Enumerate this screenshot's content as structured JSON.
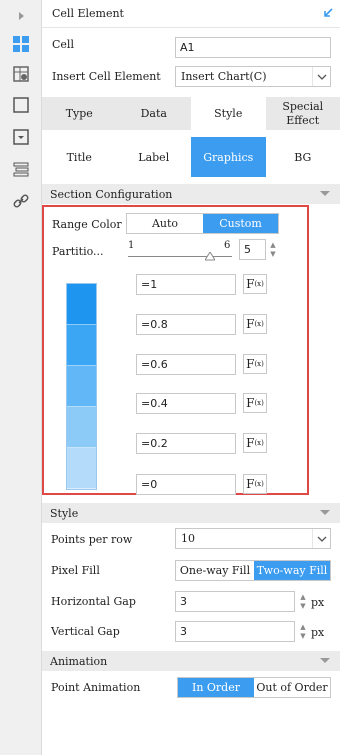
{
  "header": {
    "title": "Cell Element"
  },
  "cell": {
    "label": "Cell",
    "value": "A1"
  },
  "insert": {
    "label": "Insert Cell Element",
    "value": "Insert Chart(C)"
  },
  "tabs_top": [
    {
      "label": "Type"
    },
    {
      "label": "Data"
    },
    {
      "label": "Style"
    },
    {
      "label": "Special Effect"
    }
  ],
  "tabs_sub": [
    {
      "label": "Title"
    },
    {
      "label": "Label"
    },
    {
      "label": "Graphics"
    },
    {
      "label": "BG"
    }
  ],
  "section_config": {
    "title": "Section Configuration",
    "range_color_label": "Range Color",
    "auto": "Auto",
    "custom": "Custom",
    "partition_label": "Partitio...",
    "slider_min": "1",
    "slider_max": "6",
    "partition_value": "5",
    "ranges": [
      {
        "value": "=1"
      },
      {
        "value": "=0.8"
      },
      {
        "value": "=0.6"
      },
      {
        "value": "=0.4"
      },
      {
        "value": "=0.2"
      },
      {
        "value": "=0"
      }
    ],
    "f_label": "F",
    "f_sub": "(x)",
    "colors": [
      "#1e96f0",
      "#3aa6f4",
      "#62b8f6",
      "#8ccaf8",
      "#b4dcfa",
      "#dcedfc"
    ]
  },
  "style": {
    "title": "Style",
    "points_label": "Points per row",
    "points_value": "10",
    "pixel_fill_label": "Pixel Fill",
    "one_way": "One-way Fill",
    "two_way": "Two-way Fill",
    "hgap_label": "Horizontal Gap",
    "hgap_value": "3",
    "vgap_label": "Vertical Gap",
    "vgap_value": "3",
    "unit": "px"
  },
  "animation": {
    "title": "Animation",
    "point_label": "Point Animation",
    "in_order": "In Order",
    "out_of_order": "Out of Order"
  }
}
